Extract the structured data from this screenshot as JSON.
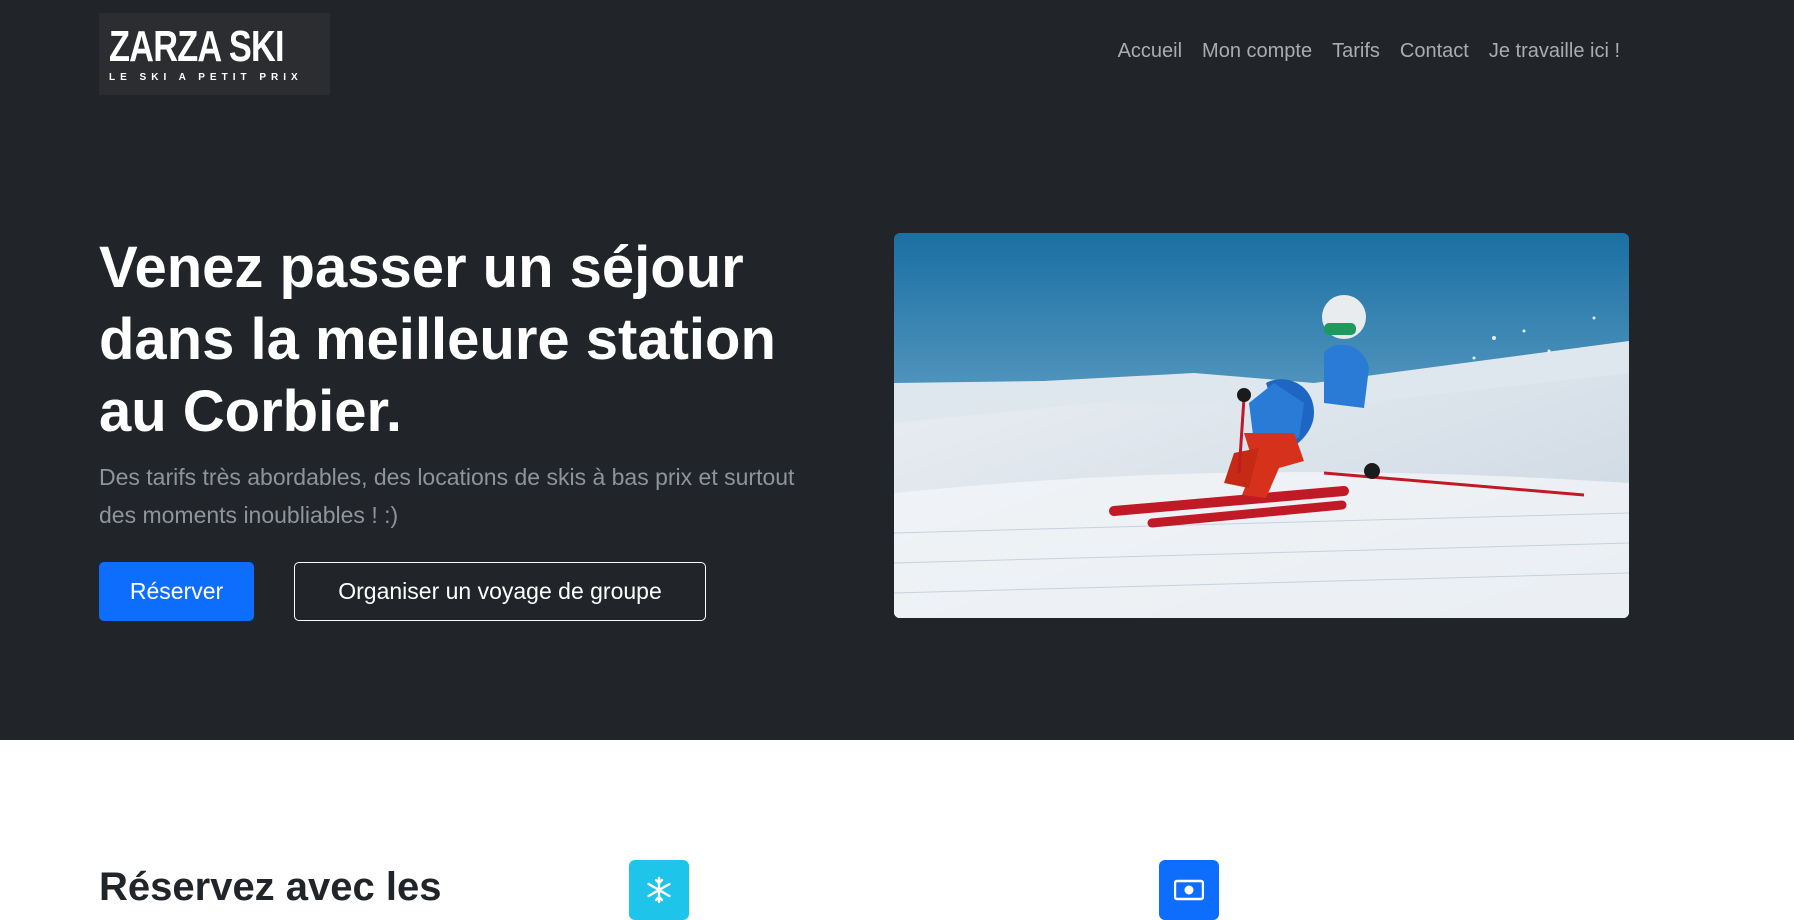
{
  "brand": {
    "name": "ZARZA SKI",
    "tagline": "LE SKI A PETIT PRIX"
  },
  "nav": {
    "items": [
      {
        "label": "Accueil"
      },
      {
        "label": "Mon compte"
      },
      {
        "label": "Tarifs"
      },
      {
        "label": "Contact"
      },
      {
        "label": "Je travaille ici !"
      }
    ]
  },
  "hero": {
    "title": "Venez passer un séjour dans la meilleure station au Corbier.",
    "lead": "Des tarifs très abordables, des locations de skis à bas prix et surtout des moments inoubliables ! :)",
    "primary_button": "Réserver",
    "secondary_button": "Organiser un voyage de groupe",
    "image_alt": "Skier descending a snowy slope"
  },
  "features": {
    "title": "Réservez avec les",
    "icons": [
      {
        "name": "snowflake-icon",
        "color": "#1fc4ea"
      },
      {
        "name": "cash-icon",
        "color": "#0d6efd"
      }
    ]
  },
  "colors": {
    "dark_bg": "#212529",
    "primary": "#0d6efd",
    "muted_text": "#8f949a",
    "nav_text": "#a9acb0",
    "cyan": "#1fc4ea"
  }
}
